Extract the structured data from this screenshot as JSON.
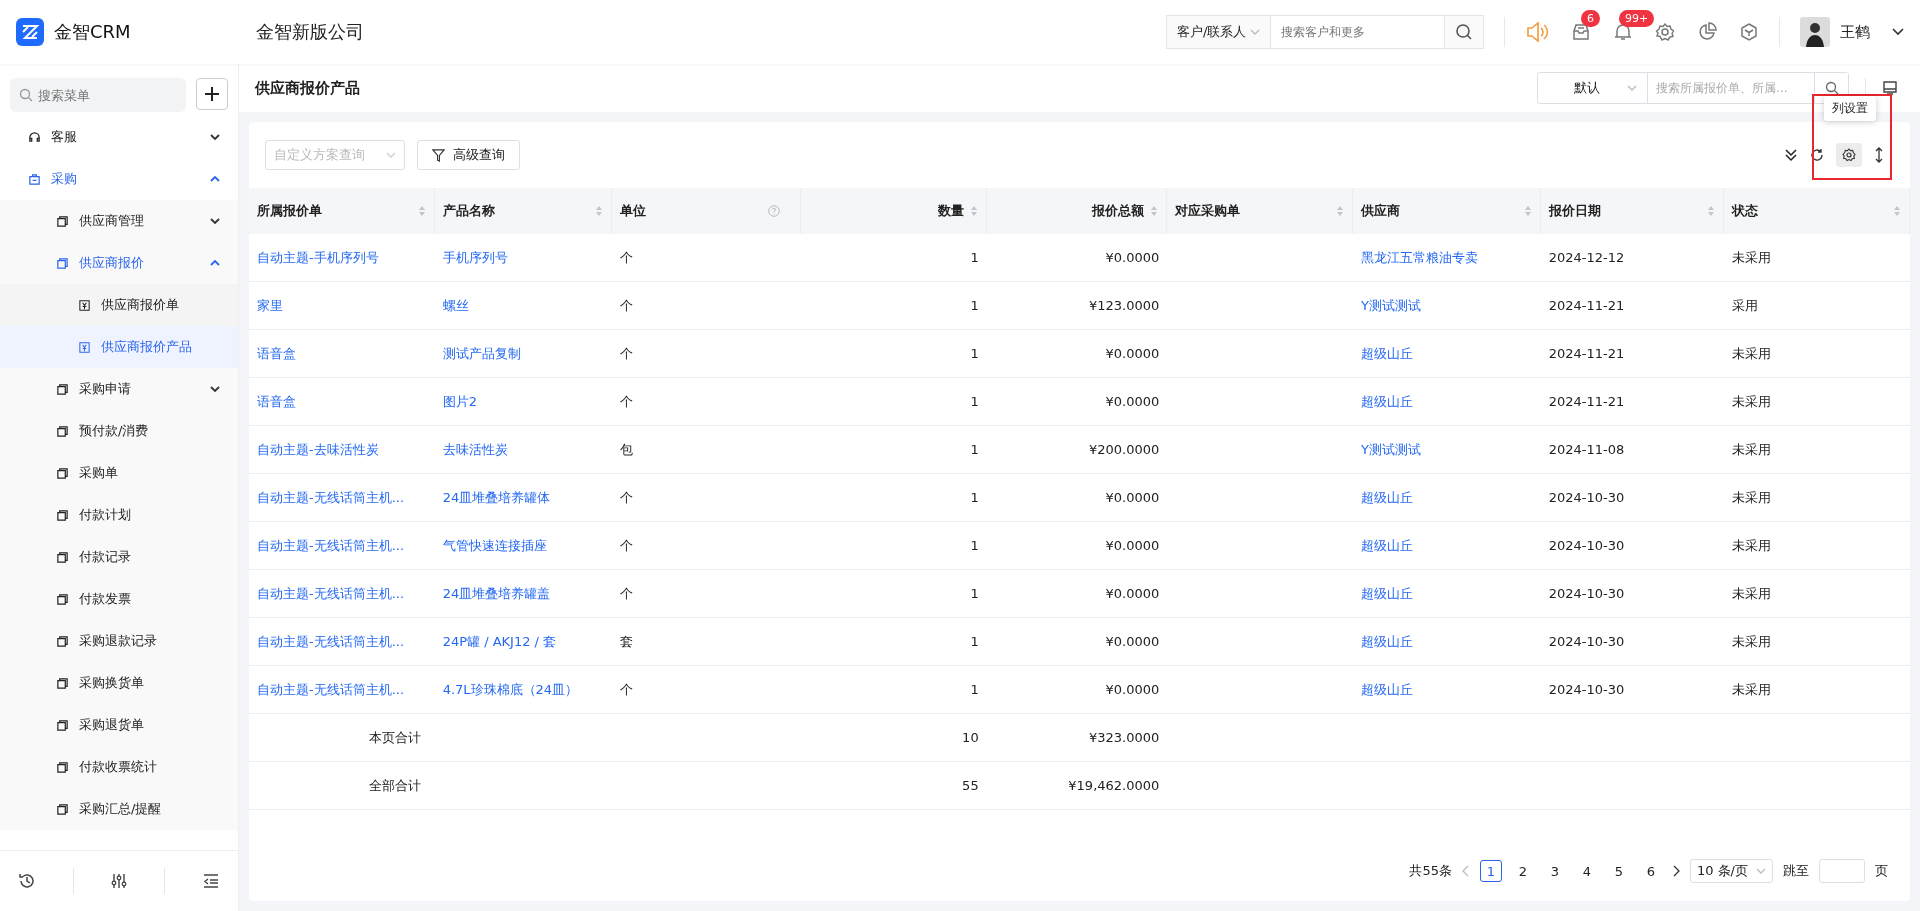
{
  "topbar": {
    "app_name": "金智CRM",
    "company": "金智新版公司",
    "search_scope": "客户/联系人",
    "search_placeholder": "搜索客户和更多",
    "badges": [
      "6",
      "99+"
    ],
    "user": "王鹤"
  },
  "sidebar": {
    "search_placeholder": "搜索菜单",
    "items": [
      {
        "label": "客服",
        "expanded": false
      },
      {
        "label": "采购",
        "expanded": true,
        "children": [
          {
            "label": "供应商管理",
            "expanded": false
          },
          {
            "label": "供应商报价",
            "expanded": true,
            "children": [
              {
                "label": "供应商报价单",
                "selected": false
              },
              {
                "label": "供应商报价产品",
                "selected": true
              }
            ]
          },
          {
            "label": "采购申请",
            "expanded": false
          },
          {
            "label": "预付款/消费",
            "selected": false
          },
          {
            "label": "采购单",
            "selected": false
          },
          {
            "label": "付款计划",
            "selected": false
          },
          {
            "label": "付款记录",
            "selected": false
          },
          {
            "label": "付款发票",
            "selected": false
          },
          {
            "label": "采购退款记录",
            "selected": false
          },
          {
            "label": "采购换货单",
            "selected": false
          },
          {
            "label": "采购退货单",
            "selected": false
          },
          {
            "label": "付款收票统计",
            "selected": false
          },
          {
            "label": "采购汇总/提醒",
            "selected": false
          }
        ]
      }
    ]
  },
  "page": {
    "title": "供应商报价产品",
    "view": "默认",
    "search_placeholder": "搜索所属报价单、所属...",
    "scheme_placeholder": "自定义方案查询",
    "advanced_button": "高级查询",
    "tooltip": "列设置"
  },
  "table": {
    "columns": [
      {
        "label": "所属报价单",
        "kind": "sortable"
      },
      {
        "label": "产品名称",
        "kind": "sortable"
      },
      {
        "label": "单位",
        "kind": "help"
      },
      {
        "label": "数量",
        "kind": "sortable_numeric"
      },
      {
        "label": "报价总额",
        "kind": "sortable_numeric"
      },
      {
        "label": "对应采购单",
        "kind": "sortable"
      },
      {
        "label": "供应商",
        "kind": "sortable"
      },
      {
        "label": "报价日期",
        "kind": "sortable"
      },
      {
        "label": "状态",
        "kind": "sortable"
      }
    ],
    "rows": [
      {
        "quote": "自动主题-手机序列号",
        "product": "手机序列号",
        "unit": "个",
        "qty": "1",
        "total": "¥0.0000",
        "supplier": "黑龙江五常粮油专卖",
        "date": "2024-12-12",
        "status": "未采用"
      },
      {
        "quote": "家里",
        "product": "螺丝",
        "unit": "个",
        "qty": "1",
        "total": "¥123.0000",
        "supplier": "Y测试测试",
        "date": "2024-11-21",
        "status": "采用"
      },
      {
        "quote": "语音盒",
        "product": "测试产品复制",
        "unit": "个",
        "qty": "1",
        "total": "¥0.0000",
        "supplier": "超级山丘",
        "date": "2024-11-21",
        "status": "未采用"
      },
      {
        "quote": "语音盒",
        "product": "图片2",
        "unit": "个",
        "qty": "1",
        "total": "¥0.0000",
        "supplier": "超级山丘",
        "date": "2024-11-21",
        "status": "未采用"
      },
      {
        "quote": "自动主题-去味活性炭",
        "product": "去味活性炭",
        "unit": "包",
        "qty": "1",
        "total": "¥200.0000",
        "supplier": "Y测试测试",
        "date": "2024-11-08",
        "status": "未采用"
      },
      {
        "quote": "自动主题-无线话筒主机...",
        "product": "24皿堆叠培养罐体",
        "unit": "个",
        "qty": "1",
        "total": "¥0.0000",
        "supplier": "超级山丘",
        "date": "2024-10-30",
        "status": "未采用"
      },
      {
        "quote": "自动主题-无线话筒主机...",
        "product": "气管快速连接插座",
        "unit": "个",
        "qty": "1",
        "total": "¥0.0000",
        "supplier": "超级山丘",
        "date": "2024-10-30",
        "status": "未采用"
      },
      {
        "quote": "自动主题-无线话筒主机...",
        "product": "24皿堆叠培养罐盖",
        "unit": "个",
        "qty": "1",
        "total": "¥0.0000",
        "supplier": "超级山丘",
        "date": "2024-10-30",
        "status": "未采用"
      },
      {
        "quote": "自动主题-无线话筒主机...",
        "product": "24P罐 / AKJ12 / 套",
        "unit": "套",
        "qty": "1",
        "total": "¥0.0000",
        "supplier": "超级山丘",
        "date": "2024-10-30",
        "status": "未采用"
      },
      {
        "quote": "自动主题-无线话筒主机...",
        "product": "4.7L珍珠棉底（24皿）",
        "unit": "个",
        "qty": "1",
        "total": "¥0.0000",
        "supplier": "超级山丘",
        "date": "2024-10-30",
        "status": "未采用"
      }
    ],
    "summary": [
      {
        "label": "本页合计",
        "qty": "10",
        "total": "¥323.0000"
      },
      {
        "label": "全部合计",
        "qty": "55",
        "total": "¥19,462.0000"
      }
    ]
  },
  "pagination": {
    "total": "共55条",
    "pages": [
      {
        "label": "1",
        "selected": true
      },
      {
        "label": "2",
        "selected": false
      },
      {
        "label": "3",
        "selected": false
      },
      {
        "label": "4",
        "selected": false
      },
      {
        "label": "5",
        "selected": false
      },
      {
        "label": "6",
        "selected": false
      }
    ],
    "page_size": "10 条/页",
    "jump_label": "跳至",
    "page_unit": "页"
  }
}
